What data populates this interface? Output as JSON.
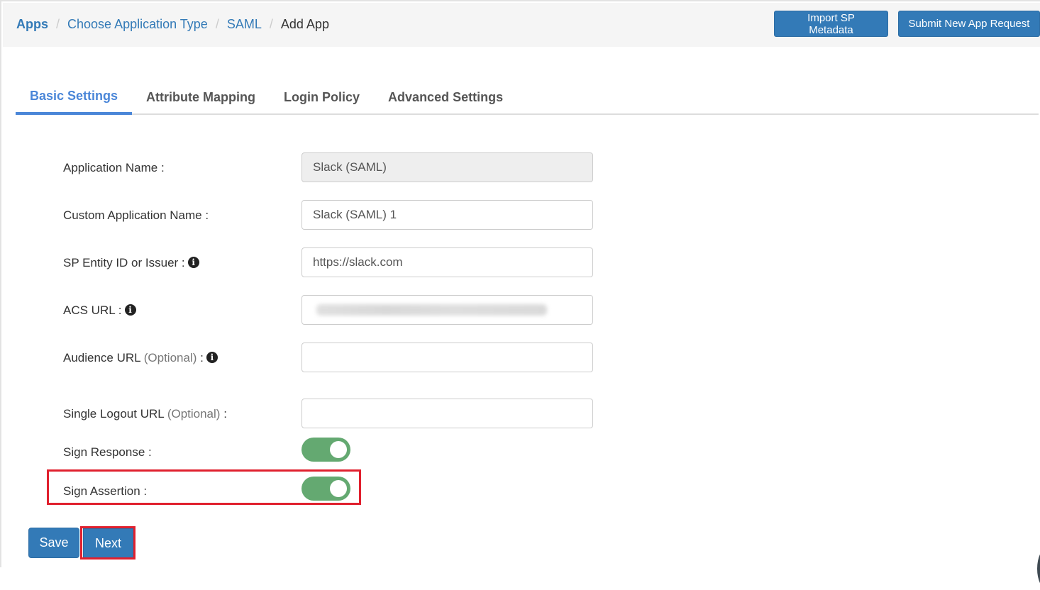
{
  "breadcrumb": {
    "items": [
      "Apps",
      "Choose Application Type",
      "SAML"
    ],
    "current": "Add App",
    "separator": "/"
  },
  "header_actions": {
    "import_label": "Import SP Metadata",
    "submit_label": "Submit New App Request"
  },
  "tabs": [
    {
      "label": "Basic Settings",
      "active": true
    },
    {
      "label": "Attribute Mapping",
      "active": false
    },
    {
      "label": "Login Policy",
      "active": false
    },
    {
      "label": "Advanced Settings",
      "active": false
    }
  ],
  "form": {
    "application_name": {
      "label": "Application Name :",
      "value": "Slack (SAML)",
      "disabled": true
    },
    "custom_application_name": {
      "label": "Custom Application Name :",
      "value": "Slack (SAML) 1"
    },
    "sp_entity_id": {
      "label": "SP Entity ID or Issuer :",
      "value": "https://slack.com",
      "info_icon": "info-circle-icon"
    },
    "acs_url": {
      "label": "ACS URL :",
      "value": "[blurred]",
      "info_icon": "info-circle-icon"
    },
    "audience_url": {
      "label": "Audience URL",
      "optional": "(Optional)",
      "suffix": ":",
      "value": "",
      "info_icon": "info-circle-icon"
    },
    "single_logout_url": {
      "label": "Single Logout URL",
      "optional": "(Optional)",
      "suffix": ":",
      "value": ""
    },
    "sign_response": {
      "label": "Sign Response :",
      "enabled": true
    },
    "sign_assertion": {
      "label": "Sign Assertion :",
      "enabled": true,
      "highlighted": true
    }
  },
  "footer": {
    "save_label": "Save",
    "next_label": "Next",
    "next_highlighted": true
  },
  "colors": {
    "primary": "#337ab7",
    "active_tab": "#4a86d8",
    "toggle_on": "#64a971",
    "highlight": "#e0202e"
  },
  "info_glyph": "i"
}
